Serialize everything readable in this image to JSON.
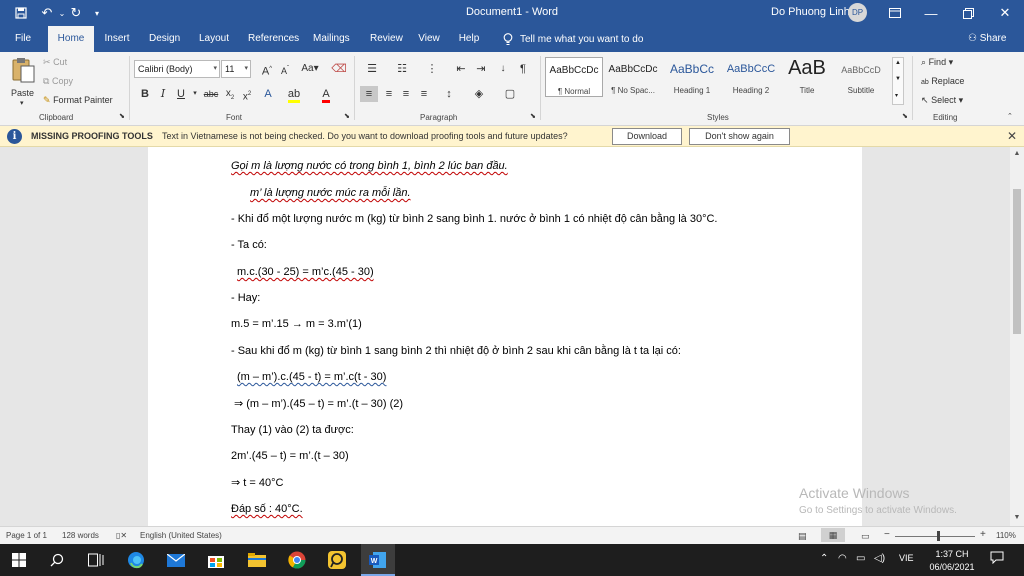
{
  "titlebar": {
    "title": "Document1 - Word",
    "user_name": "Do Phuong Linh",
    "avatar_initials": "DP"
  },
  "tabs": [
    "File",
    "Home",
    "Insert",
    "Design",
    "Layout",
    "References",
    "Mailings",
    "Review",
    "View",
    "Help"
  ],
  "tell_me": "Tell me what you want to do",
  "share": "Share",
  "ribbon": {
    "clipboard": {
      "label": "Clipboard",
      "paste": "Paste",
      "cut": "Cut",
      "copy": "Copy",
      "format_painter": "Format Painter"
    },
    "font": {
      "label": "Font",
      "font_name": "Calibri (Body)",
      "font_size": "11"
    },
    "paragraph": {
      "label": "Paragraph"
    },
    "styles": {
      "label": "Styles",
      "items": [
        {
          "sample": "AaBbCcDc",
          "name": "¶ Normal"
        },
        {
          "sample": "AaBbCcDc",
          "name": "¶ No Spac..."
        },
        {
          "sample": "AaBbCc",
          "name": "Heading 1"
        },
        {
          "sample": "AaBbCcC",
          "name": "Heading 2"
        },
        {
          "sample": "AaB",
          "name": "Title"
        },
        {
          "sample": "AaBbCcD",
          "name": "Subtitle"
        }
      ]
    },
    "editing": {
      "label": "Editing",
      "find": "Find",
      "replace": "Replace",
      "select": "Select"
    }
  },
  "message_bar": {
    "title": "MISSING PROOFING TOOLS",
    "text": "Text in Vietnamese is not being checked. Do you want to download proofing tools and future updates?",
    "download": "Download",
    "dont_show": "Don't show again"
  },
  "document": {
    "lines": [
      "Gọi m là lượng nước có trong bình 1, bình 2 lúc ban đầu.",
      "m’ là lượng nước múc ra mỗi lần.",
      "- Khi đổ một lượng nước m (kg) từ bình 2 sang bình 1. nước ở bình 1 có nhiệt độ cân bằng là 30°C.",
      "- Ta có:",
      "m.c.(30 - 25) = m’c.(45 - 30)",
      "- Hay:",
      "m.5 = m’.15 → m = 3.m’(1)",
      "- Sau khi đổ m (kg) từ bình 1 sang bình 2 thì nhiệt độ ở bình 2 sau khi cân bằng là t ta lại có:",
      "(m – m’).c.(45 - t) = m’.c(t - 30)",
      "⇒ (m – m’).(45 – t) = m’.(t – 30) (2)",
      "Thay (1) vào (2) ta được:",
      "2m’.(45 – t) = m’.(t – 30)",
      "⇒ t = 40°C",
      "Đáp số : 40°C."
    ]
  },
  "watermark": {
    "line1": "Activate Windows",
    "line2": "Go to Settings to activate Windows."
  },
  "status": {
    "page": "Page 1 of 1",
    "words": "128 words",
    "language": "English (United States)",
    "zoom": "110%"
  },
  "taskbar": {
    "language": "VIE",
    "time": "1:37 CH",
    "date": "06/06/2021"
  }
}
